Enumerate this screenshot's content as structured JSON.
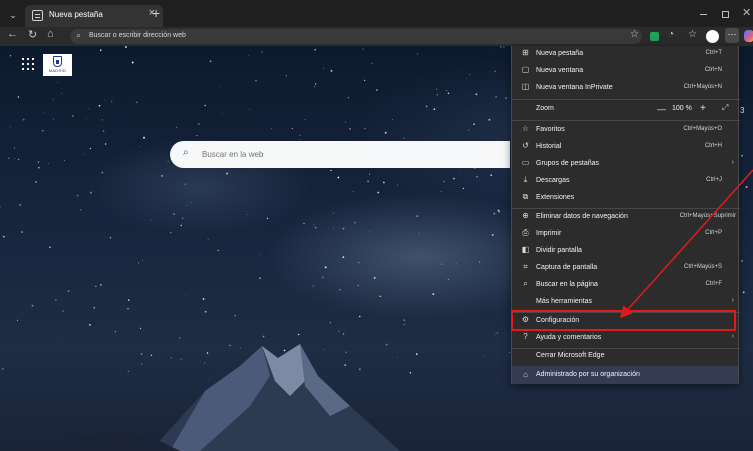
{
  "browser": {
    "tab": {
      "title": "Nueva pestaña",
      "close_glyph": "×"
    },
    "new_tab_glyph": "+",
    "address_placeholder": "Buscar o escribir dirección web",
    "icons": [
      "tab-actions-icon",
      "back-icon",
      "refresh-icon",
      "home-icon",
      "search-icon",
      "favorite-star-icon",
      "extension-icon",
      "browser-essentials-icon",
      "favorites-icon",
      "profile-icon",
      "more-icon",
      "copilot-icon"
    ]
  },
  "new_tab_page": {
    "logo_text": "MADRID",
    "search_placeholder": "Buscar en la web",
    "edge_badge": "3"
  },
  "menu": {
    "items": [
      {
        "icon": "new-tab-icon",
        "glyph": "⊞",
        "label": "Nueva pestaña",
        "shortcut": "Ctrl+T"
      },
      {
        "icon": "new-window-icon",
        "glyph": "▢",
        "label": "Nueva ventana",
        "shortcut": "Ctrl+N"
      },
      {
        "icon": "inprivate-icon",
        "glyph": "◫",
        "label": "Nueva ventana InPrivate",
        "shortcut": "Ctrl+Mayús+N"
      }
    ],
    "zoom": {
      "label": "Zoom",
      "minus": "—",
      "value": "100 %",
      "plus": "+",
      "fullscreen": "⤢"
    },
    "items2": [
      {
        "icon": "favorites-icon",
        "glyph": "☆",
        "label": "Favoritos",
        "shortcut": "Ctrl+Mayús+O"
      },
      {
        "icon": "history-icon",
        "glyph": "↺",
        "label": "Historial",
        "shortcut": "Ctrl+H"
      },
      {
        "icon": "tab-groups-icon",
        "glyph": "▭",
        "label": "Grupos de pestañas",
        "shortcut": ""
      },
      {
        "icon": "downloads-icon",
        "glyph": "⤓",
        "label": "Descargas",
        "shortcut": "Ctrl+J"
      },
      {
        "icon": "extensions-icon",
        "glyph": "⧉",
        "label": "Extensiones",
        "shortcut": ""
      }
    ],
    "items3": [
      {
        "icon": "clear-data-icon",
        "glyph": "⊕",
        "label": "Eliminar datos de navegación",
        "shortcut": "Ctrl+Mayús+Suprimir"
      },
      {
        "icon": "print-icon",
        "glyph": "⎙",
        "label": "Imprimir",
        "shortcut": "Ctrl+P"
      },
      {
        "icon": "split-screen-icon",
        "glyph": "◧",
        "label": "Dividir pantalla",
        "shortcut": ""
      },
      {
        "icon": "screenshot-icon",
        "glyph": "⌗",
        "label": "Captura de pantalla",
        "shortcut": "Ctrl+Mayús+S"
      },
      {
        "icon": "find-icon",
        "glyph": "⌕",
        "label": "Buscar en la página",
        "shortcut": "Ctrl+F"
      },
      {
        "icon": "",
        "glyph": "",
        "label": "Más herramientas",
        "shortcut": ""
      }
    ],
    "items4": [
      {
        "icon": "settings-icon",
        "glyph": "⚙",
        "label": "Configuración",
        "shortcut": ""
      },
      {
        "icon": "help-icon",
        "glyph": "?",
        "label": "Ayuda y comentarios",
        "shortcut": ""
      }
    ],
    "close_edge": "Cerrar Microsoft Edge",
    "managed": {
      "icon": "managed-icon",
      "glyph": "⌂",
      "label": "Administrado por su organización"
    },
    "submenu_arrow": "›"
  },
  "annotation": {
    "highlight_color": "#e11b1b",
    "target": "Configuración"
  }
}
